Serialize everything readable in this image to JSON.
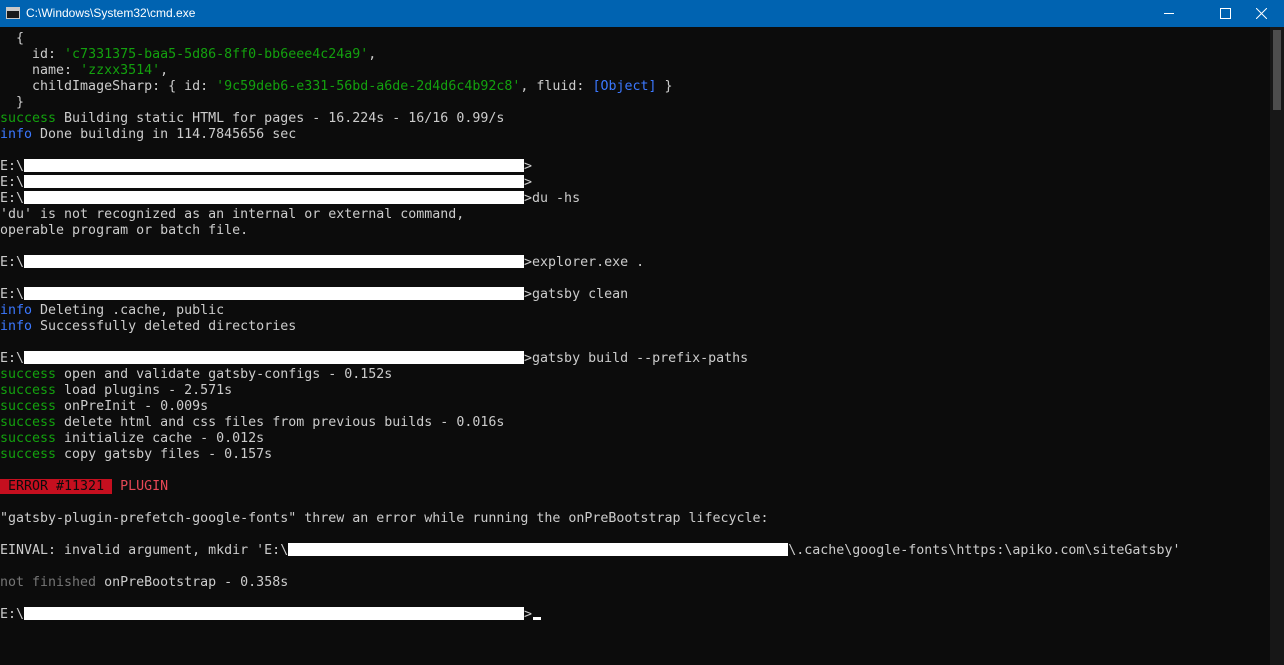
{
  "window": {
    "title": "C:\\Windows\\System32\\cmd.exe",
    "icon": "console-app-icon",
    "prompt_glyph": "C:\\"
  },
  "colors": {
    "titlebar": "#0063b1",
    "background": "#0c0c0c",
    "text": "#cccccc",
    "success": "#13a10e",
    "info": "#3b78ff",
    "error_badge": "#c50f1f"
  },
  "console": {
    "obj_open": "  {",
    "id_key": "    id: ",
    "id_val": "'c7331375-baa5-5d86-8ff0-bb6eee4c24a9'",
    "id_end": ",",
    "name_key": "    name: ",
    "name_val": "'zzxx3514'",
    "name_end": ",",
    "child_key": "    childImageSharp: { id: ",
    "child_id_val": "'9c59deb6-e331-56bd-a6de-2d4d6c4b92c8'",
    "child_mid": ", fluid: ",
    "child_fluid": "[Object]",
    "child_end": " }",
    "obj_close": "  }",
    "build_status": "success",
    "build_msg": " Building static HTML for pages - 16.224s - 16/16 0.99/s",
    "done_status": "info",
    "done_msg": " Done building in 114.7845656 sec",
    "prompt1": "E:\\",
    "suffix1": ">",
    "prompt2": "E:\\",
    "suffix2": ">",
    "prompt3": "E:\\",
    "suffix3": ">du -hs",
    "du_err1": "'du' is not recognized as an internal or external command,",
    "du_err2": "operable program or batch file.",
    "prompt4": "E:\\",
    "suffix4": ">explorer.exe .",
    "prompt5": "E:\\",
    "suffix5": ">gatsby clean",
    "clean1_status": "info",
    "clean1_msg": " Deleting .cache, public",
    "clean2_status": "info",
    "clean2_msg": " Successfully deleted directories",
    "prompt6": "E:\\",
    "suffix6": ">gatsby build --prefix-paths",
    "steps": [
      {
        "status": "success",
        "msg": " open and validate gatsby-configs - 0.152s"
      },
      {
        "status": "success",
        "msg": " load plugins - 2.571s"
      },
      {
        "status": "success",
        "msg": " onPreInit - 0.009s"
      },
      {
        "status": "success",
        "msg": " delete html and css files from previous builds - 0.016s"
      },
      {
        "status": "success",
        "msg": " initialize cache - 0.012s"
      },
      {
        "status": "success",
        "msg": " copy gatsby files - 0.157s"
      }
    ],
    "error_badge": " ERROR #11321 ",
    "error_type": " PLUGIN",
    "error_msg": "\"gatsby-plugin-prefetch-google-fonts\" threw an error while running the onPreBootstrap lifecycle:",
    "einval_prefix": "EINVAL: invalid argument, mkdir 'E:\\",
    "einval_suffix": "\\.cache\\google-fonts\\https:\\apiko.com\\siteGatsby'",
    "not_finished": "not finished",
    "not_finished_msg": " onPreBootstrap - 0.358s",
    "prompt7": "E:\\",
    "suffix7": ">"
  }
}
